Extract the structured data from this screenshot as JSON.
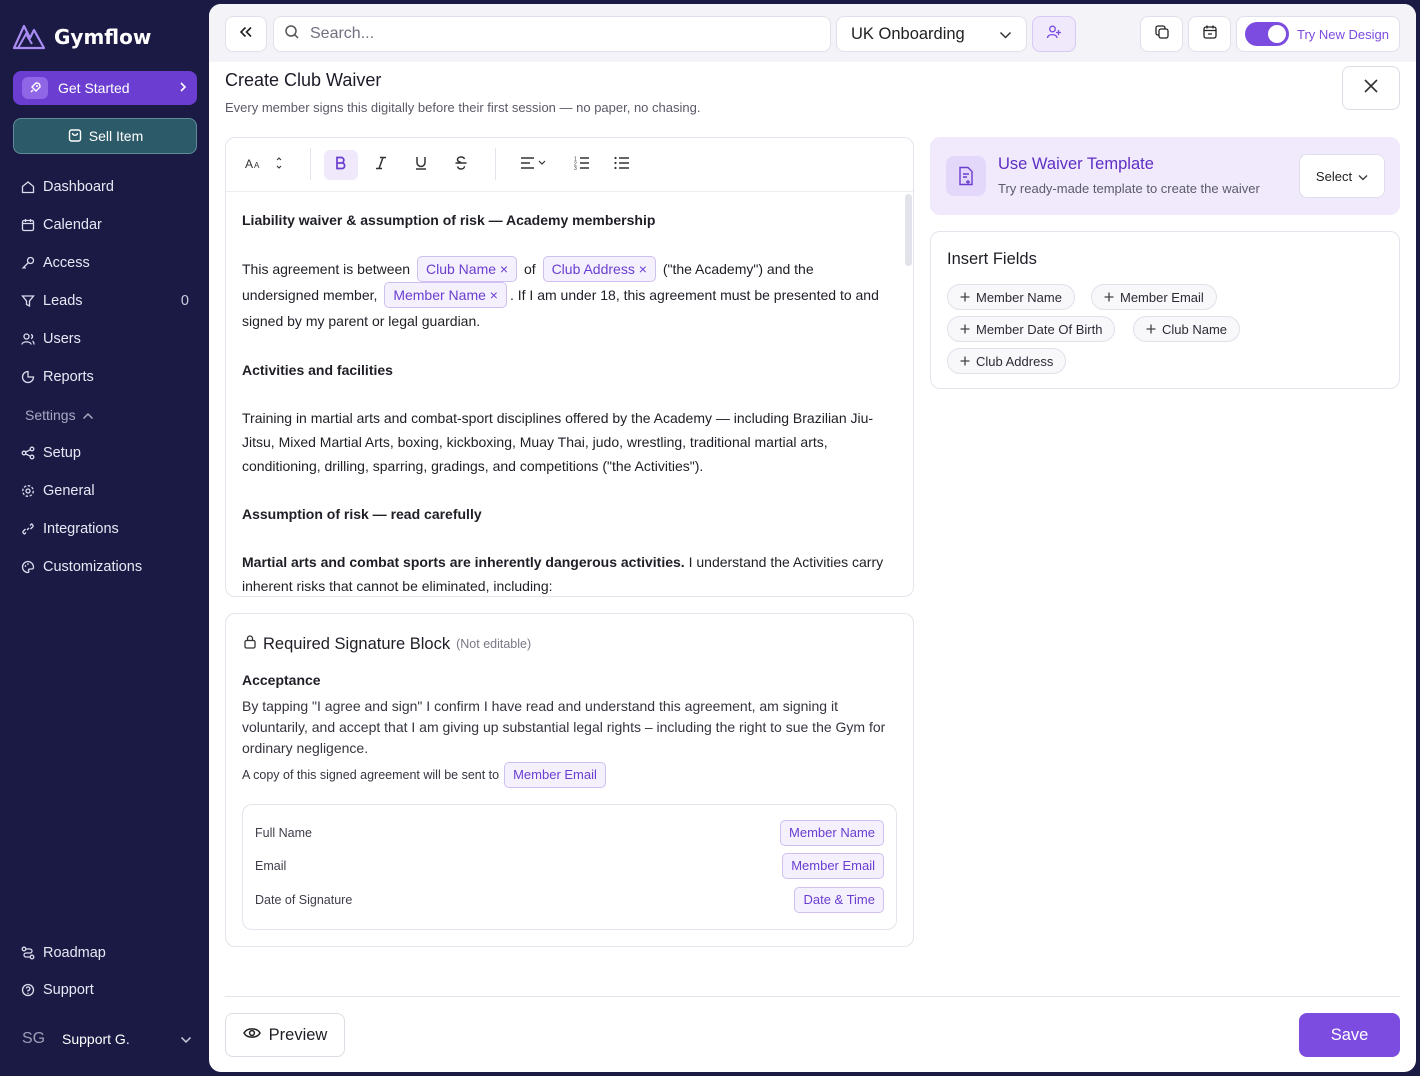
{
  "app": {
    "name": "Gymflow"
  },
  "sidebar": {
    "get_started": "Get Started",
    "sell_item": "Sell Item",
    "items": [
      {
        "label": "Dashboard",
        "icon": "home-icon"
      },
      {
        "label": "Calendar",
        "icon": "calendar-icon"
      },
      {
        "label": "Access",
        "icon": "key-icon"
      },
      {
        "label": "Leads",
        "icon": "filter-icon",
        "count": "0"
      },
      {
        "label": "Users",
        "icon": "users-icon"
      },
      {
        "label": "Reports",
        "icon": "chart-pie-icon"
      }
    ],
    "settings_label": "Settings",
    "settings_items": [
      {
        "label": "Setup",
        "icon": "setup-icon"
      },
      {
        "label": "General",
        "icon": "gear-icon"
      },
      {
        "label": "Integrations",
        "icon": "link-icon"
      },
      {
        "label": "Customizations",
        "icon": "palette-icon"
      }
    ],
    "bottom_items": [
      {
        "label": "Roadmap",
        "icon": "route-icon"
      },
      {
        "label": "Support",
        "icon": "help-icon"
      }
    ],
    "user": {
      "initials": "SG",
      "name": "Support G."
    }
  },
  "topbar": {
    "search_placeholder": "Search...",
    "location": "UK Onboarding",
    "try_new_design": "Try New Design",
    "toggle_on": true
  },
  "page": {
    "title": "Create Club Waiver",
    "subtitle": "Every member signs this digitally before their first session — no paper, no chasing."
  },
  "editor": {
    "heading": "Liability waiver & assumption of risk — Academy membership",
    "para1": {
      "t1": "This agreement is between",
      "chip1": "Club Name",
      "t2": "of",
      "chip2": "Club Address",
      "t3": "(\"the Academy\") and the undersigned member,",
      "chip3": "Member Name",
      "t4": ". If I am under 18, this agreement must be presented to and signed by my parent or legal guardian."
    },
    "heading2": "Activities and facilities",
    "para2": "Training in martial arts and combat-sport disciplines offered by the Academy — including Brazilian Jiu-Jitsu, Mixed Martial Arts, boxing, kickboxing, Muay Thai, judo, wrestling, traditional martial arts, conditioning, drilling, sparring, gradings, and competitions (\"the Activities\").",
    "heading3": "Assumption of risk — read carefully",
    "para3_bold": "Martial arts and combat sports are inherently dangerous activities.",
    "para3": " I understand the Activities carry inherent risks that cannot be eliminated, including:"
  },
  "signature": {
    "title": "Required Signature Block",
    "note": "(Not editable)",
    "acceptance": "Acceptance",
    "text": "By tapping \"I agree and sign\" I confirm I have read and understand this agreement, am signing it voluntarily, and accept that I am giving up substantial legal rights – including the right to sue the Gym for ordinary negligence.",
    "copy_text": "A copy of this signed agreement will be sent to",
    "copy_chip": "Member Email",
    "rows": [
      {
        "label": "Full Name",
        "value": "Member Name"
      },
      {
        "label": "Email",
        "value": "Member Email"
      },
      {
        "label": "Date of Signature",
        "value": "Date & Time"
      }
    ]
  },
  "template": {
    "title": "Use Waiver Template",
    "subtitle": "Try ready-made template to create the waiver",
    "select": "Select"
  },
  "insert_fields": {
    "title": "Insert Fields",
    "items": [
      "Member Name",
      "Member Email",
      "Member Date Of Birth",
      "Club Name",
      "Club Address"
    ]
  },
  "footer": {
    "preview": "Preview",
    "save": "Save"
  },
  "colors": {
    "accent": "#7c4ce0",
    "sidebar_bg": "#1a1a45",
    "sell_item_bg": "#2c5a68"
  }
}
